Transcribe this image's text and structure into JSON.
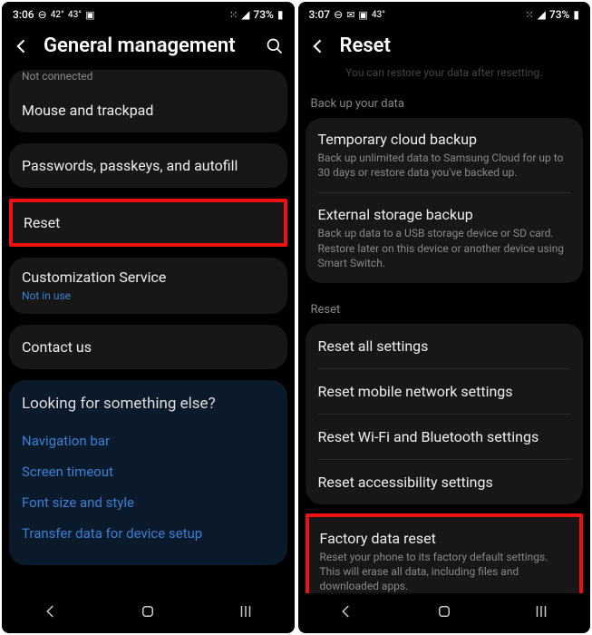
{
  "left": {
    "status": {
      "time": "3:06",
      "temp1": "42°",
      "temp2": "43°",
      "battery": "73%"
    },
    "title": "General management",
    "not_connected": "Not connected",
    "items": {
      "mouse": "Mouse and trackpad",
      "passwords": "Passwords, passkeys, and autofill",
      "reset": "Reset",
      "custom": "Customization Service",
      "custom_sub": "Not in use",
      "contact": "Contact us"
    },
    "looking": {
      "heading": "Looking for something else?",
      "links": [
        "Navigation bar",
        "Screen timeout",
        "Font size and style",
        "Transfer data for device setup"
      ]
    }
  },
  "right": {
    "status": {
      "time": "3:07",
      "temp": "43°",
      "battery": "73%"
    },
    "title": "Reset",
    "truncated": "You can restore your data after resetting.",
    "section1": "Back up your data",
    "backup": {
      "temp_title": "Temporary cloud backup",
      "temp_sub": "Back up unlimited data to Samsung Cloud for up to 30 days or restore data you've backed up.",
      "ext_title": "External storage backup",
      "ext_sub": "Back up data to a USB storage device or SD card. Restore later on this device or another device using Smart Switch."
    },
    "section2": "Reset",
    "reset": {
      "all": "Reset all settings",
      "mobile": "Reset mobile network settings",
      "wifi": "Reset Wi-Fi and Bluetooth settings",
      "access": "Reset accessibility settings",
      "factory_title": "Factory data reset",
      "factory_sub": "Reset your phone to its factory default settings. This will erase all data, including files and downloaded apps."
    }
  }
}
